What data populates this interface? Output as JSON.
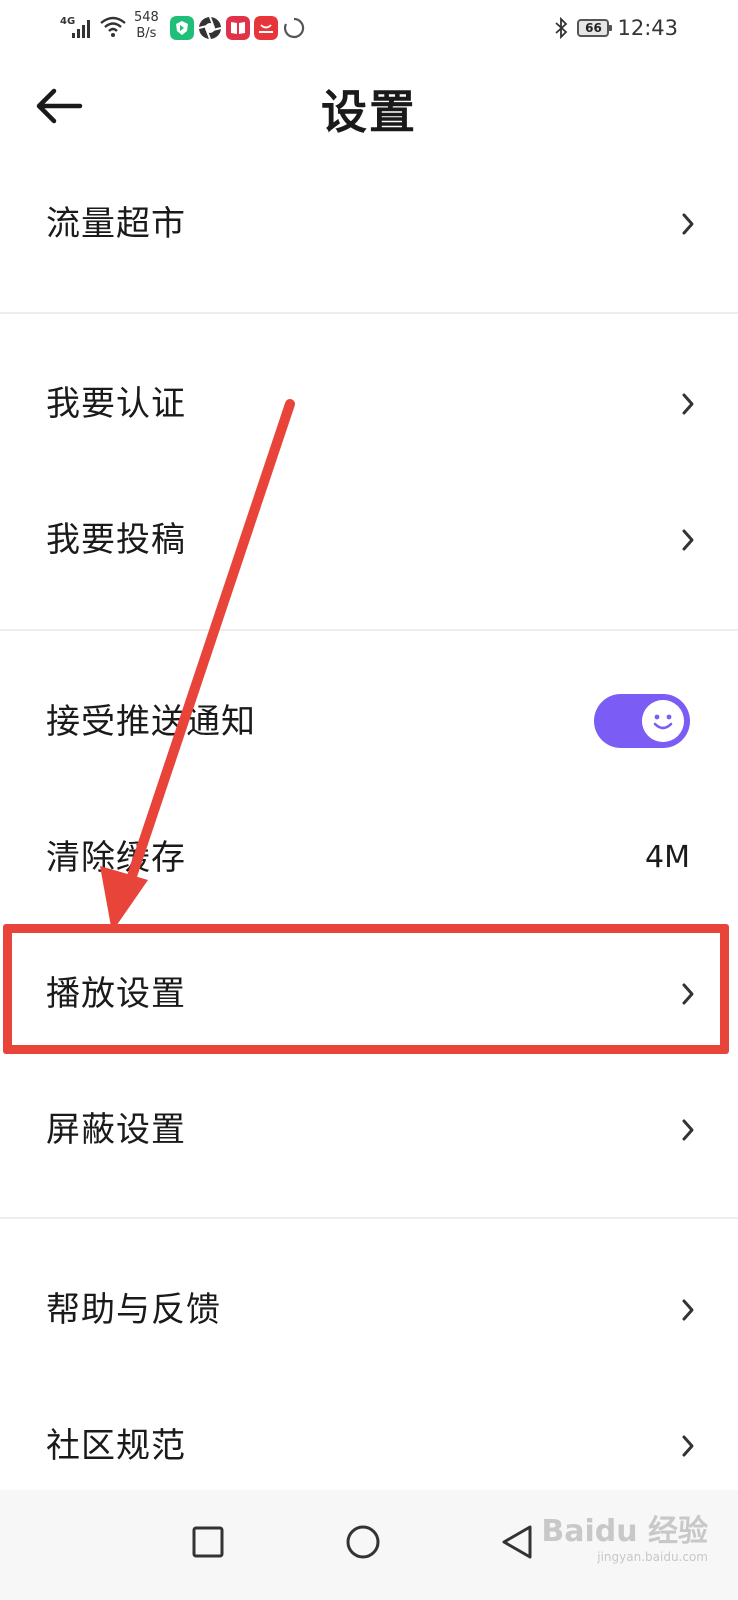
{
  "status_bar": {
    "network": "4G",
    "speed_value": "548",
    "speed_unit": "B/s",
    "battery": "66",
    "time": "12:43"
  },
  "header": {
    "title": "设置",
    "back_icon": "arrow-left-icon"
  },
  "settings": {
    "traffic_market": "流量超市",
    "certification": "我要认证",
    "submit": "我要投稿",
    "push_notifications": "接受推送通知",
    "push_notifications_enabled": true,
    "clear_cache": "清除缓存",
    "cache_size": "4M",
    "playback_settings": "播放设置",
    "block_settings": "屏蔽设置",
    "help_feedback": "帮助与反馈",
    "community_rules": "社区规范"
  },
  "colors": {
    "accent": "#7b5cf5",
    "annotation": "#e8443a",
    "divider": "#ededed"
  },
  "watermark": {
    "brand": "Baidu 经验",
    "url": "jingyan.baidu.com"
  }
}
